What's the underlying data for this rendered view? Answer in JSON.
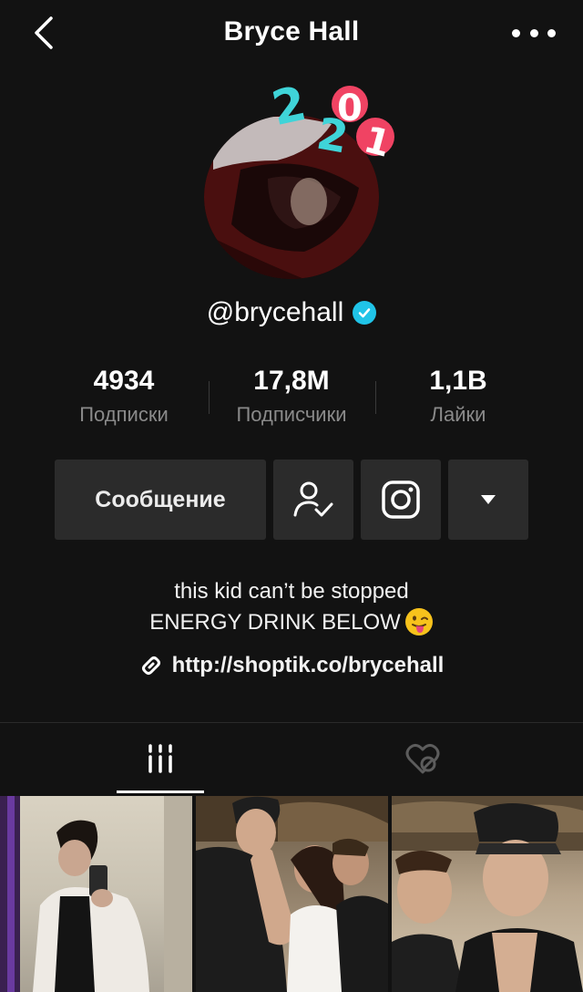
{
  "header": {
    "title": "Bryce Hall",
    "back_icon": "chevron-left-icon",
    "more_icon": "more-dots-icon"
  },
  "profile": {
    "username": "@brycehall",
    "verified_icon": "verified-badge-icon",
    "badge_text": "2021"
  },
  "stats": [
    {
      "value": "4934",
      "label": "Подписки"
    },
    {
      "value": "17,8M",
      "label": "Подписчики"
    },
    {
      "value": "1,1B",
      "label": "Лайки"
    }
  ],
  "actions": {
    "message_label": "Сообщение",
    "follow_icon": "user-check-icon",
    "instagram_icon": "instagram-icon",
    "dropdown_icon": "triangle-down-icon"
  },
  "bio": {
    "line1": "this kid can’t be stopped",
    "line2": "ENERGY DRINK BELOW",
    "emoji_icon": "tongue-out-emoji-icon",
    "link": "http://shoptik.co/brycehall",
    "link_icon": "link-icon"
  },
  "tabs": {
    "videos_icon": "grid-bars-icon",
    "liked_icon": "heart-hidden-icon",
    "active": "videos"
  },
  "colors": {
    "background": "#121212",
    "button_bg": "#2b2b2b",
    "verified": "#20c4e8",
    "muted_text": "#8a8a8a"
  }
}
